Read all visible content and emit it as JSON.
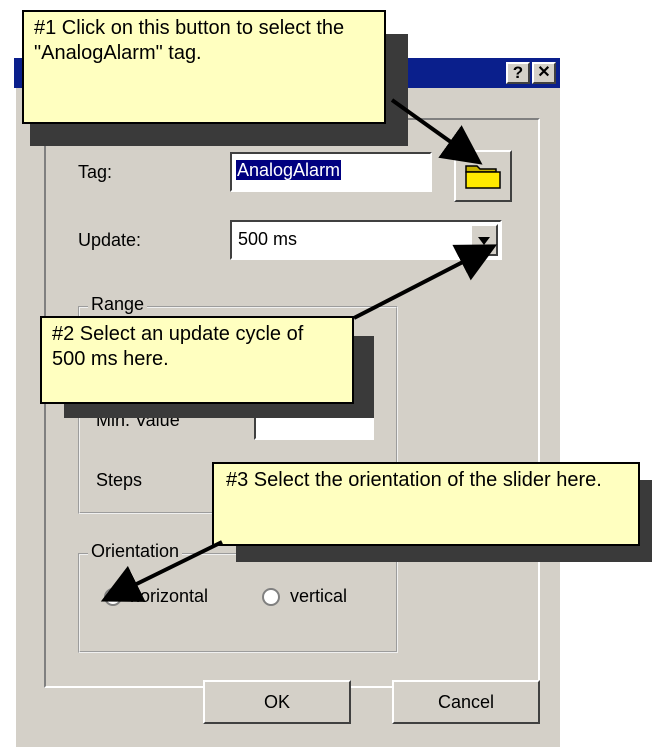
{
  "dialog": {
    "help_label": "?",
    "close_label": "✕",
    "tag_label": "Tag:",
    "tag_value": "AnalogAlarm",
    "update_label": "Update:",
    "update_value": "500 ms",
    "range_legend": "Range",
    "min_label": "Min. Value",
    "steps_label": "Steps",
    "orientation_legend": "Orientation",
    "horizontal_label": "horizontal",
    "vertical_label": "vertical",
    "ok_label": "OK",
    "cancel_label": "Cancel"
  },
  "callouts": [
    {
      "text": "#1 Click on this button to select the \"AnalogAlarm\" tag."
    },
    {
      "text": "#2 Select an update cycle of 500 ms here."
    },
    {
      "text": "#3 Select the orientation of the slider here."
    }
  ],
  "colors": {
    "titlebar": "#0a1f8c",
    "callout_bg": "#ffffc0",
    "dialog_bg": "#d4d0c8",
    "selection": "#000080"
  },
  "icons": {
    "tag_browse": "folder-icon",
    "dropdown": "chevron-down-icon"
  }
}
